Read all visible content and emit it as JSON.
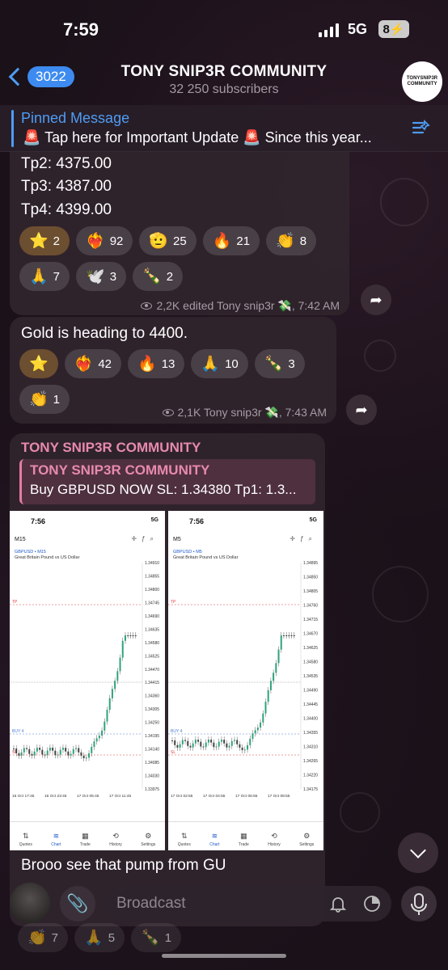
{
  "status_bar": {
    "time": "7:59",
    "network": "5G",
    "battery": "8"
  },
  "header": {
    "back_count": "3022",
    "title": "TONY SNIP3R COMMUNITY",
    "subtitle": "32 250 subscribers",
    "avatar_text": "TONYSNIP3R COMMUNITY"
  },
  "pinned": {
    "title": "Pinned Message",
    "text": "🚨 Tap here for Important Update 🚨 Since this year..."
  },
  "messages": [
    {
      "lines": [
        "Tp2: 4375.00",
        "Tp3: 4387.00",
        "Tp4: 4399.00"
      ],
      "reactions": [
        {
          "emoji": "⭐",
          "count": "2"
        },
        {
          "emoji": "❤️‍🔥",
          "count": "92"
        },
        {
          "emoji": "🫡",
          "count": "25"
        },
        {
          "emoji": "🔥",
          "count": "21"
        },
        {
          "emoji": "👏",
          "count": "8"
        },
        {
          "emoji": "🙏",
          "count": "7"
        },
        {
          "emoji": "🕊️",
          "count": "3"
        },
        {
          "emoji": "🍾",
          "count": "2"
        }
      ],
      "meta": "2,2K edited Tony snip3r 💸, 7:42 AM"
    },
    {
      "text": "Gold is heading to 4400.",
      "reactions": [
        {
          "emoji": "⭐",
          "count": ""
        },
        {
          "emoji": "❤️‍🔥",
          "count": "42"
        },
        {
          "emoji": "🔥",
          "count": "13"
        },
        {
          "emoji": "🙏",
          "count": "10"
        },
        {
          "emoji": "🍾",
          "count": "3"
        },
        {
          "emoji": "👏",
          "count": "1"
        }
      ],
      "meta": "2,1K Tony snip3r 💸, 7:43 AM"
    },
    {
      "from": "TONY SNIP3R COMMUNITY",
      "quote_title": "TONY SNIP3R COMMUNITY",
      "quote_text": "Buy GBPUSD NOW SL: 1.34380 Tp1: 1.3...",
      "text": "Brooo see that pump from GU",
      "peek_reactions": [
        {
          "emoji": "👏",
          "count": "7"
        },
        {
          "emoji": "🙏",
          "count": "5"
        },
        {
          "emoji": "🍾",
          "count": "1"
        }
      ]
    }
  ],
  "screenshots": [
    {
      "time": "7:56",
      "status": "5G",
      "timeframe": "M15",
      "symbol": "GBPUSD • M15",
      "name": "Great Britain Pound vs US Dollar",
      "prices": [
        "1.34910",
        "1.34855",
        "1.34800",
        "1.34745",
        "1.34690",
        "1.34635",
        "1.34580",
        "1.34525",
        "1.34470",
        "1.34415",
        "1.34360",
        "1.34305",
        "1.34250",
        "1.34195",
        "1.34140",
        "1.34085",
        "1.34030",
        "1.33975"
      ],
      "dates": [
        "16 Oct 17:45",
        "16 Oct 23:45",
        "17 Oct 05:45",
        "17 Oct 11:45"
      ],
      "lines": [
        "TP",
        "BUY 4",
        "SL"
      ]
    },
    {
      "time": "7:56",
      "status": "5G",
      "timeframe": "M5",
      "symbol": "GBPUSD • M5",
      "name": "Great Britain Pound vs US Dollar",
      "prices": [
        "1.34895",
        "1.34850",
        "1.34805",
        "1.34760",
        "1.34715",
        "1.34670",
        "1.34625",
        "1.34580",
        "1.34535",
        "1.34490",
        "1.34445",
        "1.34400",
        "1.34355",
        "1.34310",
        "1.34265",
        "1.34220",
        "1.34175"
      ],
      "dates": [
        "17 Oct 02:55",
        "17 Oct 04:55",
        "17 Oct 06:55",
        "17 Oct 08:55"
      ],
      "lines": [
        "TP",
        "BUY 4",
        "SL"
      ]
    }
  ],
  "app_nav": [
    "Quotes",
    "Chart",
    "Trade",
    "History",
    "Settings"
  ],
  "input": {
    "placeholder": "Broadcast"
  },
  "colors": {
    "accent": "#4f9cf3",
    "bubble": "#30242c",
    "quote": "#e78aac"
  }
}
